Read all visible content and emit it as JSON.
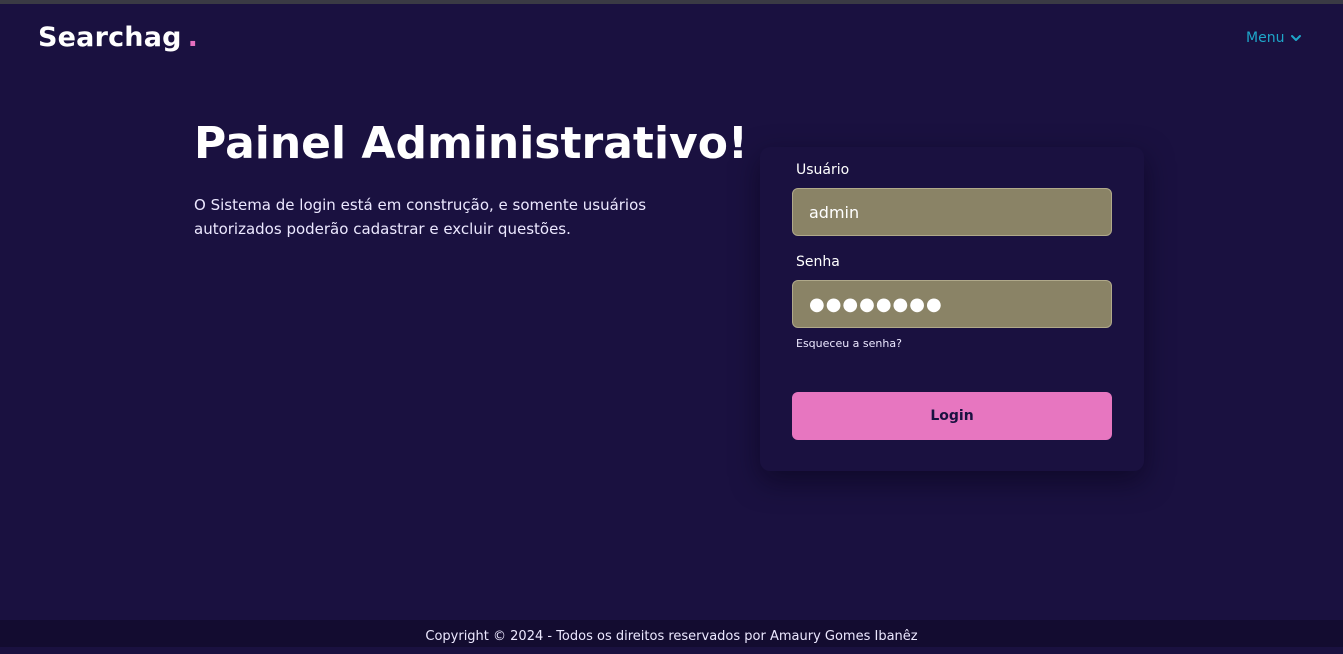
{
  "header": {
    "brand": "Searchag",
    "brand_dot": ".",
    "menu_label": "Menu"
  },
  "hero": {
    "title": "Painel Administrativo!",
    "description": "O Sistema de login está em construção, e somente usuários autorizados poderão cadastrar e excluir questões."
  },
  "login_form": {
    "username_label": "Usuário",
    "username_value": "admin",
    "password_label": "Senha",
    "password_masked": "●●●●●●●●",
    "forgot_link": "Esqueceu a senha?",
    "submit_label": "Login"
  },
  "footer": {
    "copyright": "Copyright © 2024 - Todos os direitos reservados por Amaury Gomes Ibanêz"
  },
  "colors": {
    "background": "#1a1140",
    "accent_pink": "#e776c0",
    "menu_link": "#1ea6c9",
    "input_fill": "#8a8366"
  }
}
